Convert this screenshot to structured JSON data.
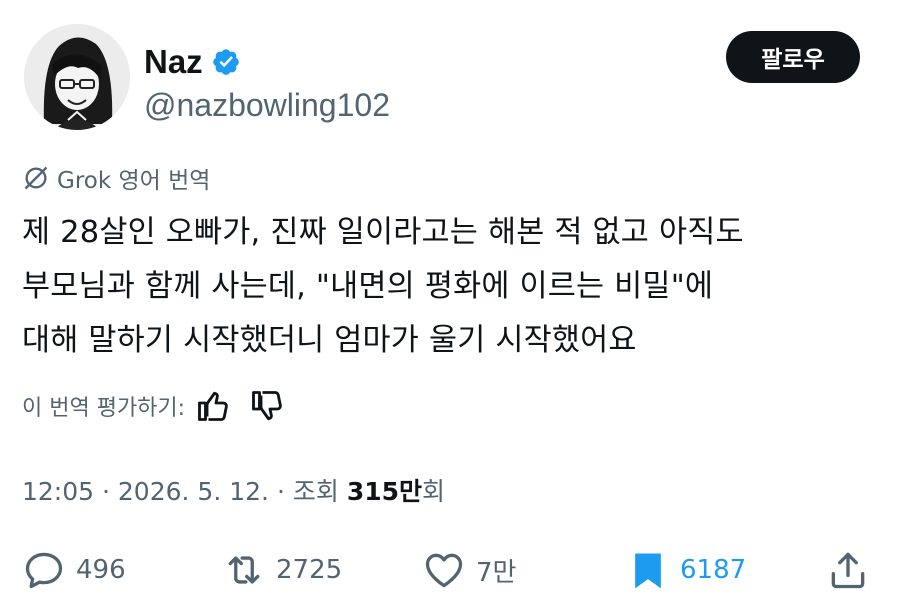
{
  "user": {
    "name": "Naz",
    "handle": "@nazbowling102",
    "verified": true
  },
  "follow_label": "팔로우",
  "translation": {
    "label": "Grok 영어 번역"
  },
  "tweet": {
    "lines": [
      "제 28살인 오빠가, 진짜 일이라고는 해본 적 없고 아직도",
      "부모님과 함께 사는데, \"내면의 평화에 이르는 비밀\"에",
      "대해 말하기 시작했더니 엄마가 울기 시작했어요"
    ]
  },
  "rating": {
    "label": "이 번역 평가하기:"
  },
  "meta": {
    "time": "12:05",
    "sep1": "·",
    "date": "2026. 5. 12.",
    "sep2": "·",
    "views_label": "조회",
    "views_num": "315만",
    "views_suffix": "회"
  },
  "actions": {
    "replies": "496",
    "retweets": "2725",
    "likes": "7만",
    "bookmarks": "6187"
  },
  "colors": {
    "accent": "#1d9bf0",
    "muted": "#536471",
    "text": "#0f1419"
  }
}
